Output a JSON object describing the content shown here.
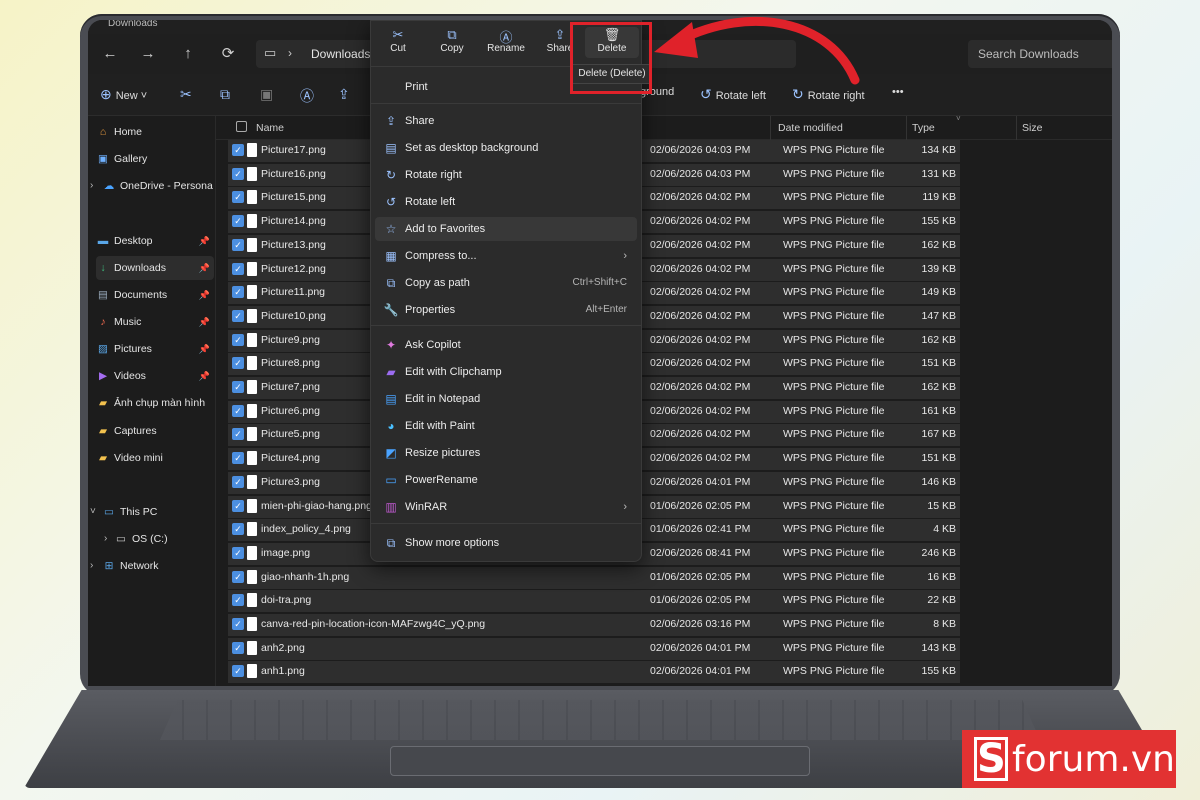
{
  "window": {
    "tab_title": "Downloads"
  },
  "nav": {
    "back": "←",
    "forward": "→",
    "up": "↑",
    "refresh": "⟳",
    "breadcrumb": "Downloads",
    "search_placeholder": "Search Downloads"
  },
  "toolbar": {
    "new_label": "New",
    "bg_label": "ground",
    "rotate_left": "Rotate left",
    "rotate_right": "Rotate right",
    "more": "•••"
  },
  "sidebar": {
    "items": [
      {
        "label": "Home"
      },
      {
        "label": "Gallery"
      },
      {
        "label": "OneDrive - Persona"
      },
      {
        "label": "Desktop"
      },
      {
        "label": "Downloads"
      },
      {
        "label": "Documents"
      },
      {
        "label": "Music"
      },
      {
        "label": "Pictures"
      },
      {
        "label": "Videos"
      },
      {
        "label": "Ảnh chụp màn hình"
      },
      {
        "label": "Captures"
      },
      {
        "label": "Video mini"
      },
      {
        "label": "This PC"
      },
      {
        "label": "OS (C:)"
      },
      {
        "label": "Network"
      }
    ]
  },
  "columns": {
    "name": "Name",
    "date": "Date modified",
    "type": "Type",
    "size": "Size"
  },
  "files": [
    {
      "name": "Picture17.png",
      "date": "02/06/2026 04:03 PM",
      "type": "WPS PNG Picture file",
      "size": "134 KB"
    },
    {
      "name": "Picture16.png",
      "date": "02/06/2026 04:03 PM",
      "type": "WPS PNG Picture file",
      "size": "131 KB"
    },
    {
      "name": "Picture15.png",
      "date": "02/06/2026 04:02 PM",
      "type": "WPS PNG Picture file",
      "size": "119 KB"
    },
    {
      "name": "Picture14.png",
      "date": "02/06/2026 04:02 PM",
      "type": "WPS PNG Picture file",
      "size": "155 KB"
    },
    {
      "name": "Picture13.png",
      "date": "02/06/2026 04:02 PM",
      "type": "WPS PNG Picture file",
      "size": "162 KB"
    },
    {
      "name": "Picture12.png",
      "date": "02/06/2026 04:02 PM",
      "type": "WPS PNG Picture file",
      "size": "139 KB"
    },
    {
      "name": "Picture11.png",
      "date": "02/06/2026 04:02 PM",
      "type": "WPS PNG Picture file",
      "size": "149 KB"
    },
    {
      "name": "Picture10.png",
      "date": "02/06/2026 04:02 PM",
      "type": "WPS PNG Picture file",
      "size": "147 KB"
    },
    {
      "name": "Picture9.png",
      "date": "02/06/2026 04:02 PM",
      "type": "WPS PNG Picture file",
      "size": "162 KB"
    },
    {
      "name": "Picture8.png",
      "date": "02/06/2026 04:02 PM",
      "type": "WPS PNG Picture file",
      "size": "151 KB"
    },
    {
      "name": "Picture7.png",
      "date": "02/06/2026 04:02 PM",
      "type": "WPS PNG Picture file",
      "size": "162 KB"
    },
    {
      "name": "Picture6.png",
      "date": "02/06/2026 04:02 PM",
      "type": "WPS PNG Picture file",
      "size": "161 KB"
    },
    {
      "name": "Picture5.png",
      "date": "02/06/2026 04:02 PM",
      "type": "WPS PNG Picture file",
      "size": "167 KB"
    },
    {
      "name": "Picture4.png",
      "date": "02/06/2026 04:02 PM",
      "type": "WPS PNG Picture file",
      "size": "151 KB"
    },
    {
      "name": "Picture3.png",
      "date": "02/06/2026 04:01 PM",
      "type": "WPS PNG Picture file",
      "size": "146 KB"
    },
    {
      "name": "mien-phi-giao-hang.png",
      "date": "01/06/2026 02:05 PM",
      "type": "WPS PNG Picture file",
      "size": "15 KB"
    },
    {
      "name": "index_policy_4.png",
      "date": "01/06/2026 02:41 PM",
      "type": "WPS PNG Picture file",
      "size": "4 KB"
    },
    {
      "name": "image.png",
      "date": "02/06/2026 08:41 PM",
      "type": "WPS PNG Picture file",
      "size": "246 KB"
    },
    {
      "name": "giao-nhanh-1h.png",
      "date": "01/06/2026 02:05 PM",
      "type": "WPS PNG Picture file",
      "size": "16 KB"
    },
    {
      "name": "doi-tra.png",
      "date": "01/06/2026 02:05 PM",
      "type": "WPS PNG Picture file",
      "size": "22 KB"
    },
    {
      "name": "canva-red-pin-location-icon-MAFzwg4C_yQ.png",
      "date": "02/06/2026 03:16 PM",
      "type": "WPS PNG Picture file",
      "size": "8 KB"
    },
    {
      "name": "anh2.png",
      "date": "02/06/2026 04:01 PM",
      "type": "WPS PNG Picture file",
      "size": "143 KB"
    },
    {
      "name": "anh1.png",
      "date": "02/06/2026 04:01 PM",
      "type": "WPS PNG Picture file",
      "size": "155 KB"
    }
  ],
  "context_menu": {
    "actions": [
      {
        "label": "Cut",
        "icon": "cut-icon"
      },
      {
        "label": "Copy",
        "icon": "copy-icon"
      },
      {
        "label": "Rename",
        "icon": "rename-icon"
      },
      {
        "label": "Share",
        "icon": "share-icon"
      },
      {
        "label": "Delete",
        "icon": "delete-icon"
      }
    ],
    "tooltip": "Delete (Delete)",
    "items": [
      {
        "label": "Print",
        "shortcut": ""
      },
      {
        "label": "Share",
        "shortcut": ""
      },
      {
        "label": "Set as desktop background",
        "shortcut": ""
      },
      {
        "label": "Rotate right",
        "shortcut": ""
      },
      {
        "label": "Rotate left",
        "shortcut": ""
      },
      {
        "label": "Add to Favorites",
        "shortcut": ""
      },
      {
        "label": "Compress to...",
        "shortcut": ""
      },
      {
        "label": "Copy as path",
        "shortcut": "Ctrl+Shift+C"
      },
      {
        "label": "Properties",
        "shortcut": "Alt+Enter"
      },
      {
        "label": "Ask Copilot",
        "shortcut": ""
      },
      {
        "label": "Edit with Clipchamp",
        "shortcut": ""
      },
      {
        "label": "Edit in Notepad",
        "shortcut": ""
      },
      {
        "label": "Edit with Paint",
        "shortcut": ""
      },
      {
        "label": "Resize pictures",
        "shortcut": ""
      },
      {
        "label": "PowerRename",
        "shortcut": ""
      },
      {
        "label": "WinRAR",
        "shortcut": ""
      },
      {
        "label": "Show more options",
        "shortcut": ""
      }
    ]
  },
  "brand": {
    "logo_letter": "S",
    "logo_text": "forum.vn"
  },
  "colors": {
    "highlight": "#e0222a",
    "accent": "#4c8fe0",
    "brand": "#e23232"
  }
}
